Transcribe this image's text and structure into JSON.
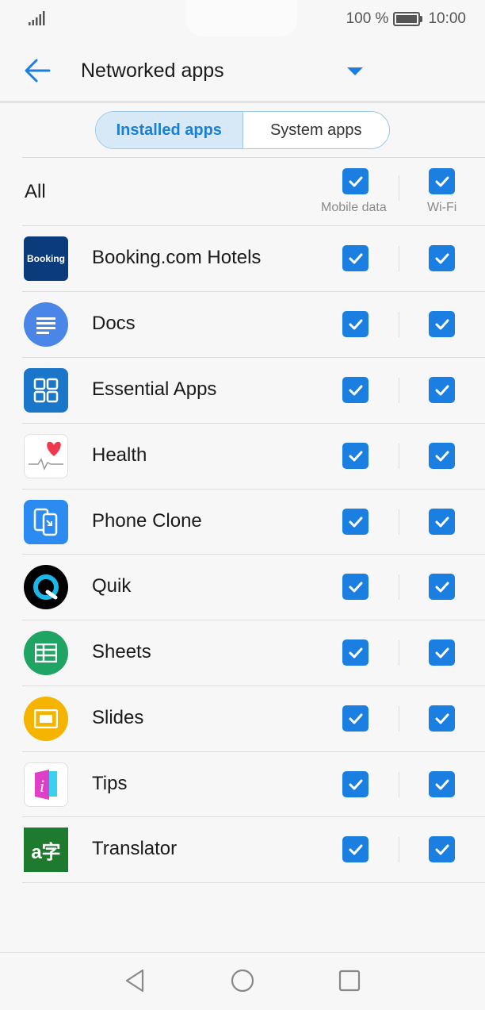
{
  "status_bar": {
    "battery_text": "100 %",
    "time": "10:00"
  },
  "header": {
    "title": "Networked apps"
  },
  "tabs": [
    {
      "label": "Installed apps",
      "active": true
    },
    {
      "label": "System apps",
      "active": false
    }
  ],
  "all_row": {
    "label": "All",
    "mobile_label": "Mobile data",
    "wifi_label": "Wi-Fi",
    "mobile_checked": true,
    "wifi_checked": true
  },
  "apps": [
    {
      "name": "Booking.com Hotels",
      "icon": "booking-icon",
      "icon_text": "Booking",
      "mobile": true,
      "wifi": true
    },
    {
      "name": "Docs",
      "icon": "docs-icon",
      "mobile": true,
      "wifi": true
    },
    {
      "name": "Essential Apps",
      "icon": "essential-apps-icon",
      "mobile": true,
      "wifi": true
    },
    {
      "name": "Health",
      "icon": "health-icon",
      "mobile": true,
      "wifi": true
    },
    {
      "name": "Phone Clone",
      "icon": "phone-clone-icon",
      "mobile": true,
      "wifi": true
    },
    {
      "name": "Quik",
      "icon": "quik-icon",
      "mobile": true,
      "wifi": true
    },
    {
      "name": "Sheets",
      "icon": "sheets-icon",
      "mobile": true,
      "wifi": true
    },
    {
      "name": "Slides",
      "icon": "slides-icon",
      "mobile": true,
      "wifi": true
    },
    {
      "name": "Tips",
      "icon": "tips-icon",
      "mobile": true,
      "wifi": true
    },
    {
      "name": "Translator",
      "icon": "translator-icon",
      "icon_text": "a字",
      "mobile": true,
      "wifi": true
    }
  ],
  "colors": {
    "accent": "#1a7fe0",
    "tab_active_bg": "#d7e9f7"
  }
}
